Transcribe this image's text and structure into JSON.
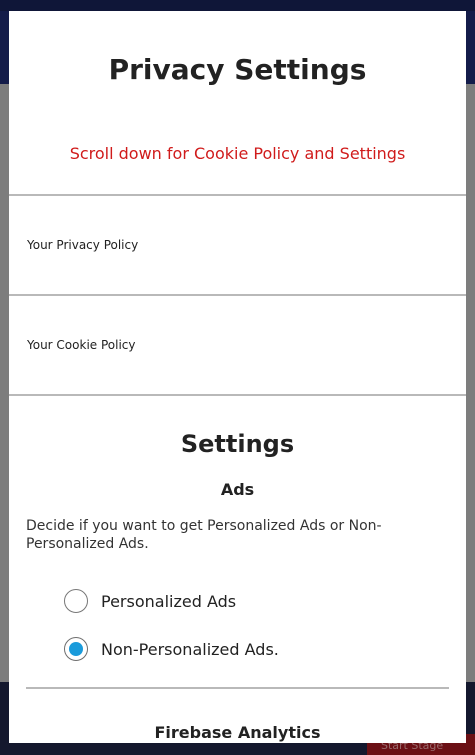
{
  "background": {
    "footer_button_label": "Start Stage"
  },
  "dialog": {
    "title": "Privacy Settings",
    "notice": "Scroll down for Cookie Policy and Settings",
    "links": {
      "privacy_policy": "Your Privacy Policy",
      "cookie_policy": "Your Cookie Policy"
    },
    "settings": {
      "heading": "Settings",
      "ads": {
        "heading": "Ads",
        "description": "Decide if you want to get Personalized Ads or Non-Personalized Ads.",
        "options": [
          {
            "label": "Personalized Ads",
            "selected": false
          },
          {
            "label": "Non-Personalized Ads.",
            "selected": true
          }
        ]
      },
      "analytics_heading": "Firebase Analytics"
    }
  },
  "colors": {
    "notice": "#d01b1b",
    "radio_selected": "#1a9bdb"
  }
}
